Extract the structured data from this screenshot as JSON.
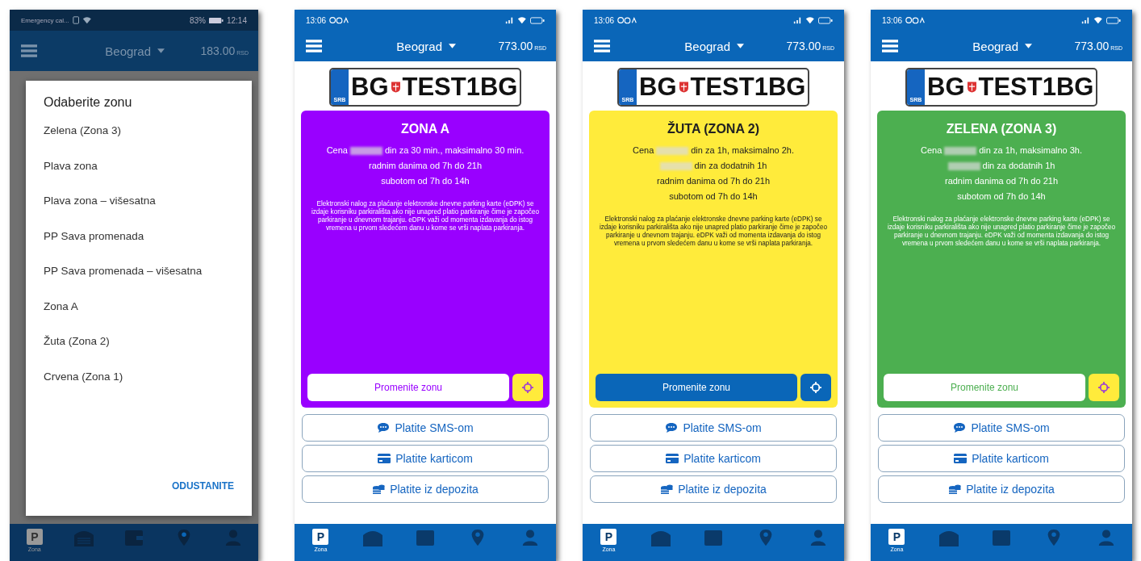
{
  "phones": [
    {
      "kind": "dialog",
      "status": {
        "left": "Emergency cal...",
        "battery": "83%",
        "time": "12:14"
      },
      "header": {
        "city": "Beograd",
        "balance": "183.00",
        "currency": "RSD"
      },
      "dialog": {
        "title": "Odaberite zonu",
        "options": [
          "Zelena (Zona 3)",
          "Plava zona",
          "Plava zona – višesatna",
          "PP Sava promenada",
          "PP Sava promenada – višesatna",
          "Zona A",
          "Žuta (Zona 2)",
          "Crvena (Zona 1)"
        ],
        "cancel": "ODUSTANITE"
      },
      "nav": [
        {
          "kind": "parking",
          "glyph": "P",
          "label": "Zona",
          "selected": true
        },
        {
          "kind": "garage",
          "selected": false
        },
        {
          "kind": "wallet",
          "selected": false
        },
        {
          "kind": "pin",
          "selected": false
        },
        {
          "kind": "person",
          "selected": false
        }
      ]
    },
    {
      "kind": "zone",
      "status": {
        "time": "13:06"
      },
      "header": {
        "city": "Beograd",
        "balance": "773.00",
        "currency": "RSD"
      },
      "plate": {
        "country": "SRB",
        "city": "BG",
        "number": "TEST1BG"
      },
      "zone": {
        "kind": "vivid",
        "title": "ZONA A",
        "color": "#9900ff",
        "lines": [
          {
            "kind": "price",
            "before": "Cena",
            "after": "din za 30 min., maksimalno 30 min."
          },
          {
            "kind": "plain",
            "text": "radnim danima od 7h do 21h"
          },
          {
            "kind": "plain",
            "text": "subotom od 7h do 14h"
          }
        ],
        "note": "Elektronski nalog za plaćanje elektronske dnevne parking karte (eDPK) se izdaje korisniku parkirališta ako nije unapred platio parkiranje čime je započeo parkiranje u dnevnom trajanju. eDPK važi od momenta izdavanja do istog vremena u prvom sledećem danu u kome se vrši naplata parkiranja.",
        "change": {
          "label": "Promenite zonu"
        }
      },
      "payments": [
        {
          "kind": "sms",
          "label": "Platite SMS-om"
        },
        {
          "kind": "card",
          "label": "Platite karticom"
        },
        {
          "kind": "deposit",
          "label": "Platite iz depozita"
        }
      ],
      "nav": [
        {
          "kind": "parking",
          "glyph": "P",
          "label": "Zona",
          "selected": true
        },
        {
          "kind": "garage",
          "selected": false
        },
        {
          "kind": "wallet",
          "selected": false
        },
        {
          "kind": "pin",
          "selected": false
        },
        {
          "kind": "person",
          "selected": false
        }
      ]
    },
    {
      "kind": "zone",
      "status": {
        "time": "13:06"
      },
      "header": {
        "city": "Beograd",
        "balance": "773.00",
        "currency": "RSD"
      },
      "plate": {
        "country": "SRB",
        "city": "BG",
        "number": "TEST1BG"
      },
      "zone": {
        "kind": "pale",
        "title": "ŽUTA (ZONA 2)",
        "color": "#ffeb3b",
        "lines": [
          {
            "kind": "price",
            "before": "Cena",
            "after": "din za 1h, maksimalno 2h."
          },
          {
            "kind": "price",
            "after": "din za dodatnih 1h"
          },
          {
            "kind": "plain",
            "text": "radnim danima od 7h do 21h"
          },
          {
            "kind": "plain",
            "text": "subotom od 7h do 14h"
          }
        ],
        "note": "Elektronski nalog za plaćanje elektronske dnevne parking karte (eDPK) se izdaje korisniku parkirališta ako nije unapred platio parkiranje čime je započeo parkiranje u dnevnom trajanju. eDPK važi od momenta izdavanja do istog vremena u prvom sledećem danu u kome se vrši naplata parkiranja.",
        "change": {
          "label": "Promenite zonu"
        }
      },
      "payments": [
        {
          "kind": "sms",
          "label": "Platite SMS-om"
        },
        {
          "kind": "card",
          "label": "Platite karticom"
        },
        {
          "kind": "deposit",
          "label": "Platite iz depozita"
        }
      ],
      "nav": [
        {
          "kind": "parking",
          "glyph": "P",
          "label": "Zona",
          "selected": true
        },
        {
          "kind": "garage",
          "selected": false
        },
        {
          "kind": "wallet",
          "selected": false
        },
        {
          "kind": "pin",
          "selected": false
        },
        {
          "kind": "person",
          "selected": false
        }
      ]
    },
    {
      "kind": "zone",
      "status": {
        "time": "13:06"
      },
      "header": {
        "city": "Beograd",
        "balance": "773.00",
        "currency": "RSD"
      },
      "plate": {
        "country": "SRB",
        "city": "BG",
        "number": "TEST1BG"
      },
      "zone": {
        "kind": "vivid",
        "title": "ZELENA (ZONA 3)",
        "color": "#4caf50",
        "lines": [
          {
            "kind": "price",
            "before": "Cena",
            "after": "din za 1h, maksimalno 3h."
          },
          {
            "kind": "price",
            "after": "din za dodatnih 1h"
          },
          {
            "kind": "plain",
            "text": "radnim danima od 7h do 21h"
          },
          {
            "kind": "plain",
            "text": "subotom od 7h do 14h"
          }
        ],
        "note": "Elektronski nalog za plaćanje elektronske dnevne parking karte (eDPK) se izdaje korisniku parkirališta ako nije unapred platio parkiranje čime je započeo parkiranje u dnevnom trajanju. eDPK važi od momenta izdavanja do istog vremena u prvom sledećem danu u kome se vrši naplata parkiranja.",
        "change": {
          "label": "Promenite zonu"
        }
      },
      "payments": [
        {
          "kind": "sms",
          "label": "Platite SMS-om"
        },
        {
          "kind": "card",
          "label": "Platite karticom"
        },
        {
          "kind": "deposit",
          "label": "Platite iz depozita"
        }
      ],
      "nav": [
        {
          "kind": "parking",
          "glyph": "P",
          "label": "Zona",
          "selected": true
        },
        {
          "kind": "garage",
          "selected": false
        },
        {
          "kind": "wallet",
          "selected": false
        },
        {
          "kind": "pin",
          "selected": false
        },
        {
          "kind": "person",
          "selected": false
        }
      ]
    }
  ]
}
